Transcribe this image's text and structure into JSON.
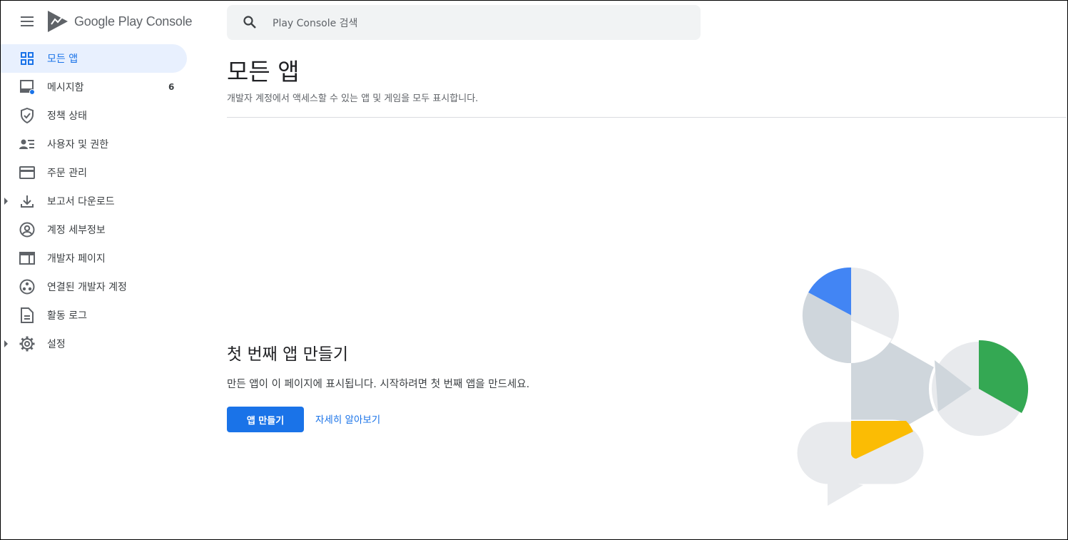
{
  "app": {
    "logo_word1": "Google Play",
    "logo_word2": "Console"
  },
  "search": {
    "placeholder": "Play Console 검색"
  },
  "sidebar": {
    "items": [
      {
        "label": "모든 앱",
        "icon": "grid-icon",
        "active": true
      },
      {
        "label": "메시지함",
        "icon": "inbox-icon",
        "count": "6"
      },
      {
        "label": "정책 상태",
        "icon": "shield-icon"
      },
      {
        "label": "사용자 및 권한",
        "icon": "users-list-icon"
      },
      {
        "label": "주문 관리",
        "icon": "credit-card-icon"
      },
      {
        "label": "보고서 다운로드",
        "icon": "download-icon",
        "expandable": true
      },
      {
        "label": "계정 세부정보",
        "icon": "account-circle-icon"
      },
      {
        "label": "개발자 페이지",
        "icon": "web-page-icon"
      },
      {
        "label": "연결된 개발자 계정",
        "icon": "linked-accounts-icon"
      },
      {
        "label": "활동 로그",
        "icon": "document-icon"
      },
      {
        "label": "설정",
        "icon": "gear-icon",
        "expandable": true
      }
    ]
  },
  "main": {
    "title": "모든 앱",
    "subtitle": "개발자 계정에서 액세스할 수 있는 앱 및 게임을 모두 표시합니다.",
    "empty_state": {
      "title": "첫 번째 앱 만들기",
      "text": "만든 앱이 이 페이지에 표시됩니다. 시작하려면 첫 번째 앱을 만드세요.",
      "primary_button": "앱 만들기",
      "learn_more": "자세히 알아보기"
    }
  },
  "colors": {
    "accent": "#1a73e8",
    "active_bg": "#e8f0fe",
    "illus_blue": "#4285f4",
    "illus_green": "#34a853",
    "illus_yellow": "#fbbc04"
  }
}
